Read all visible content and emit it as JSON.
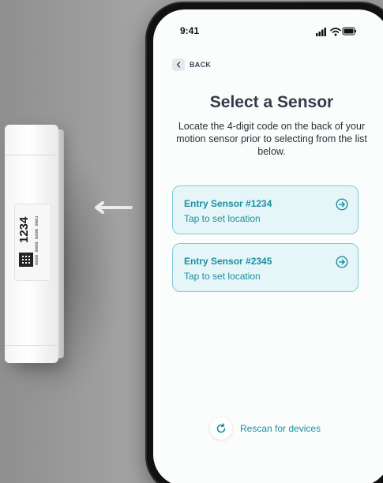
{
  "phone": {
    "status_time": "9:41",
    "back_label": "BACK",
    "title": "Select a Sensor",
    "subtitle": "Locate the 4-digit code on the back of your motion sensor prior to selecting from the list below.",
    "sensors": [
      {
        "name": "Entry Sensor #1234",
        "action": "Tap to set location"
      },
      {
        "name": "Entry Sensor #2345",
        "action": "Tap to set location"
      }
    ],
    "rescan_label": "Rescan for devices"
  },
  "device": {
    "code": "1234",
    "serial": "0000 0000 0000 0001"
  },
  "colors": {
    "accent": "#1d8ea0",
    "card_bg": "#e6f6f8",
    "card_border": "#7dcbd6",
    "title": "#343a4a"
  },
  "icons": {
    "back": "chevron-left-icon",
    "card_action": "arrow-circle-right-icon",
    "rescan": "refresh-icon",
    "signal": "cellular-signal-icon",
    "wifi": "wifi-icon",
    "battery": "battery-icon"
  }
}
